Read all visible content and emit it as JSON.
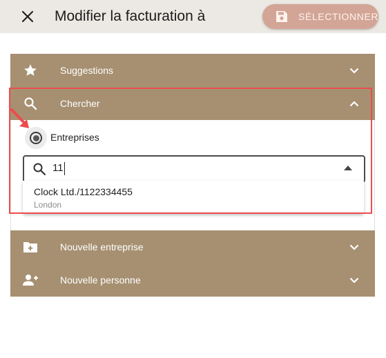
{
  "header": {
    "close_icon": "close-icon",
    "title": "Modifier la facturation à",
    "select_label": "SÉLECTIONNER",
    "select_icon": "save-icon",
    "button_color": "#d3a596"
  },
  "accordion": {
    "header_color": "#a69071",
    "suggestions": {
      "label": "Suggestions",
      "icon": "star-icon",
      "expanded": false
    },
    "search": {
      "label": "Chercher",
      "icon": "search-icon",
      "expanded": true,
      "radio_label": "Entreprises",
      "radio_checked": true,
      "input_value": "11",
      "results": [
        {
          "title": "Clock Ltd./1122334455",
          "subtitle": "London"
        }
      ]
    },
    "new_company": {
      "label": "Nouvelle entreprise",
      "icon": "folder-add-icon",
      "expanded": false
    },
    "new_person": {
      "label": "Nouvelle personne",
      "icon": "person-add-icon",
      "expanded": false
    }
  },
  "annotation": {
    "highlight_color": "#ec4d4d"
  }
}
